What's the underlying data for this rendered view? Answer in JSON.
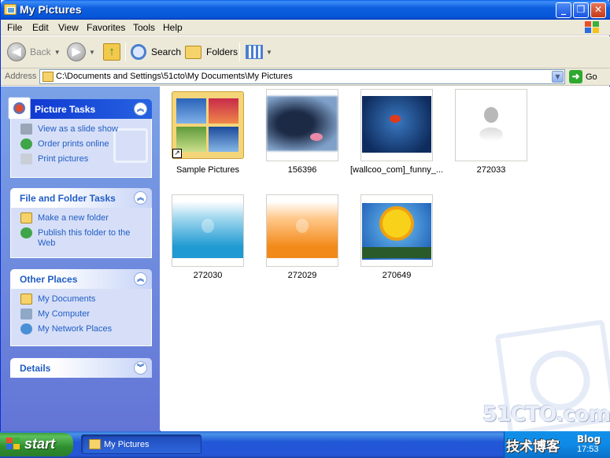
{
  "window": {
    "title": "My Pictures"
  },
  "menu": [
    "File",
    "Edit",
    "View",
    "Favorites",
    "Tools",
    "Help"
  ],
  "toolbar": {
    "back": "Back",
    "search": "Search",
    "folders": "Folders"
  },
  "address": {
    "label": "Address",
    "path": "C:\\Documents and Settings\\51cto\\My Documents\\My Pictures",
    "go": "Go"
  },
  "panels": {
    "picture_tasks": {
      "title": "Picture Tasks",
      "items": [
        "View as a slide show",
        "Order prints online",
        "Print pictures"
      ]
    },
    "file_folder_tasks": {
      "title": "File and Folder Tasks",
      "items": [
        "Make a new folder",
        "Publish this folder to the Web"
      ]
    },
    "other_places": {
      "title": "Other Places",
      "items": [
        "My Documents",
        "My Computer",
        "My Network Places"
      ]
    },
    "details": {
      "title": "Details"
    }
  },
  "files": [
    {
      "label": "Sample Pictures"
    },
    {
      "label": "156396"
    },
    {
      "label": "[wallcoo_com]_funny_..."
    },
    {
      "label": "272033"
    },
    {
      "label": "272030"
    },
    {
      "label": "272029"
    },
    {
      "label": "270649"
    }
  ],
  "watermark": {
    "brand": "51CTO.com"
  },
  "taskbar": {
    "start": "start",
    "task_label": "My Pictures",
    "tray_brand": "技术博客",
    "tray_blog": "Blog",
    "time": "17:53"
  },
  "colors": {
    "titlebar": "#0a5fe8",
    "taskpane": "#7ba2e7",
    "link": "#215dc6",
    "start_green": "#3c9e3c"
  }
}
